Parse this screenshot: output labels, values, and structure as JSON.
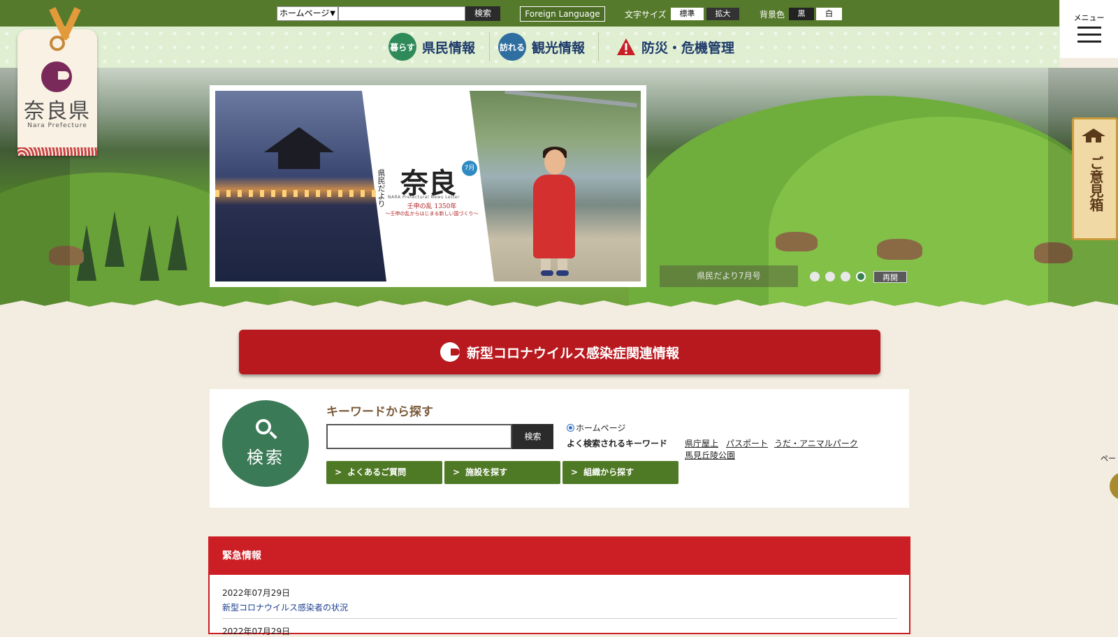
{
  "topbar": {
    "scope_select": "ホームページ",
    "search_button": "検索",
    "foreign_language": "Foreign Language",
    "font_size_label": "文字サイズ",
    "font_standard": "標準",
    "font_large": "拡大",
    "bg_color_label": "背景色",
    "bg_black": "黒",
    "bg_white": "白"
  },
  "menu": {
    "label": "メニュー"
  },
  "logo": {
    "name": "奈良県",
    "english": "Nara Prefecture"
  },
  "nav": [
    {
      "badge": "暮らす",
      "label": "県民情報",
      "color": "#2f8a5a"
    },
    {
      "badge": "訪れる",
      "label": "観光情報",
      "color": "#2f6ea0"
    },
    {
      "label": "防災・危機管理",
      "color": "#c81e25"
    }
  ],
  "slider": {
    "newsletter_small": "県民だより",
    "newsletter_big": "奈良",
    "newsletter_badge": "7月",
    "newsletter_en": "NARA Prefectural News Letter",
    "newsletter_red": "壬申の乱 1350年",
    "newsletter_red2": "〜壬申の乱からはじまる新しい国づくり〜",
    "caption": "県民だより7月号",
    "dots": 4,
    "active_dot": 4,
    "resume": "再開"
  },
  "opinion_box": {
    "label": "ご意見箱"
  },
  "covid_banner": {
    "label": "新型コロナウイルス感染症関連情報"
  },
  "search": {
    "badge": "検索",
    "title": "キーワードから探す",
    "input_value": "",
    "button": "検索",
    "radio_label": "ホームページ",
    "popular_label": "よく検索されるキーワード",
    "popular_keywords": [
      "県庁屋上",
      "パスポート",
      "うだ・アニマルパーク",
      "馬見丘陵公園"
    ],
    "buttons": [
      "よくあるご質問",
      "施設を探す",
      "組織から探す"
    ]
  },
  "emergency": {
    "heading": "緊急情報",
    "items": [
      {
        "date": "2022年07月29日",
        "title": "新型コロナウイルス感染者の状況"
      },
      {
        "date": "2022年07月29日"
      }
    ]
  },
  "page_top": {
    "label": "ペー"
  }
}
